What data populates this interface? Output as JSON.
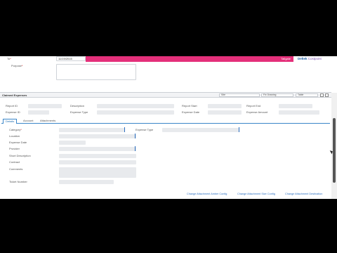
{
  "top": {
    "to_label": "To",
    "to_value": "11/19/2015",
    "purpose_label": "Purpose",
    "required_mark": "*",
    "action_button": "Tallgate",
    "brand_name": "Deltek",
    "brand_product": "Costpoint"
  },
  "claimed": {
    "title": "Claimed Expenses",
    "filter1": "Site",
    "filter2": "Fix Drawing",
    "filter3": "Table",
    "labels": {
      "report_id": "Report ID",
      "description": "Description",
      "report_start": "Report Start",
      "report_end": "Report End",
      "expense_id": "Expense ID",
      "expense_type": "Expense Type",
      "expense_date": "Expense Date",
      "expense_amount": "Expense Amount"
    }
  },
  "tabs": [
    "Details",
    "Account",
    "Attachments"
  ],
  "details": {
    "category": "Category",
    "expense_type": "Expense Type",
    "location": "Location",
    "expense_date": "Expense Date",
    "provider": "Provider",
    "short_description": "Short Description",
    "contract": "Contract",
    "comments": "Comments",
    "ticket_number": "Ticket Number"
  },
  "footer": {
    "link1": "Change Attachment Amber Config",
    "link2": "Change Attachment Size Config",
    "link3": "Change Attachment Destination"
  },
  "colors": {
    "accent_pink": "#e4307a",
    "brand_blue": "#1a5aa0",
    "tab_blue": "#3a86c8"
  }
}
